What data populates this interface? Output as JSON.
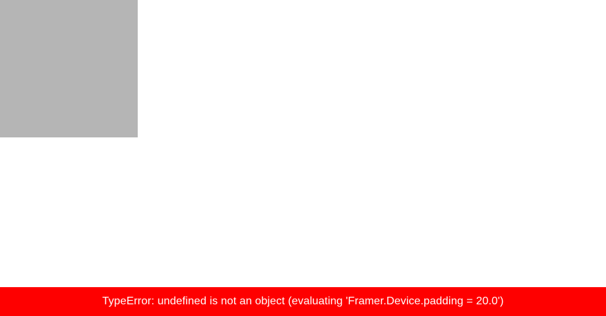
{
  "canvas": {
    "background_color": "#ffffff"
  },
  "layer": {
    "color": "#b5b5b5"
  },
  "error": {
    "message": "TypeError: undefined is not an object (evaluating 'Framer.Device.padding = 20.0')",
    "background_color": "#fe0000",
    "text_color": "#ffffff"
  }
}
